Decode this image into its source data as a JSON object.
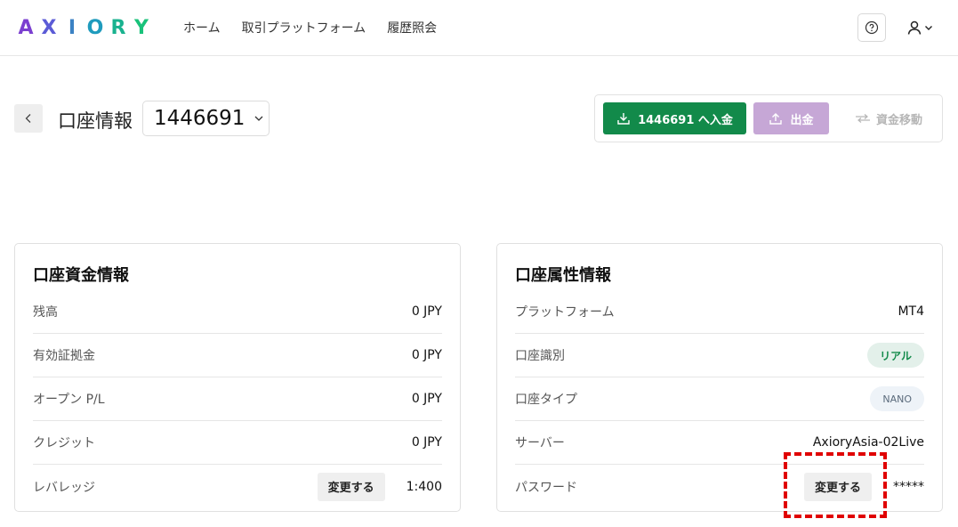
{
  "header": {
    "logo_letters": [
      "A",
      "X",
      "I",
      "O",
      "R",
      "Y"
    ],
    "logo_colors": [
      "#7b3fd0",
      "#5b5bd6",
      "#3b82c4",
      "#1f9bbd",
      "#19b28f",
      "#19c27a"
    ],
    "nav": [
      "ホーム",
      "取引プラットフォーム",
      "履歴照会"
    ],
    "help_icon": "question-circle-icon",
    "user_icon": "user-icon"
  },
  "page": {
    "title": "口座情報",
    "account_number": "1446691"
  },
  "actions": {
    "deposit_label": "1446691 へ入金",
    "withdraw_label": "出金",
    "transfer_label": "資金移動",
    "deposit_color": "#128a4a",
    "withdraw_color": "#c6a7d6"
  },
  "funds_card": {
    "title": "口座資金情報",
    "rows": [
      {
        "label": "残高",
        "value": "0 JPY"
      },
      {
        "label": "有効証拠金",
        "value": "0 JPY"
      },
      {
        "label": "オープン P/L",
        "value": "0 JPY"
      },
      {
        "label": "クレジット",
        "value": "0 JPY"
      },
      {
        "label": "レバレッジ",
        "value": "1:400",
        "button": "変更する"
      }
    ]
  },
  "attr_card": {
    "title": "口座属性情報",
    "rows": [
      {
        "label": "プラットフォーム",
        "value": "MT4"
      },
      {
        "label": "口座識別",
        "value": "リアル"
      },
      {
        "label": "口座タイプ",
        "value": "NANO"
      },
      {
        "label": "サーバー",
        "value": "AxioryAsia-02Live"
      },
      {
        "label": "パスワード",
        "value": "*****",
        "button": "変更する"
      }
    ]
  }
}
